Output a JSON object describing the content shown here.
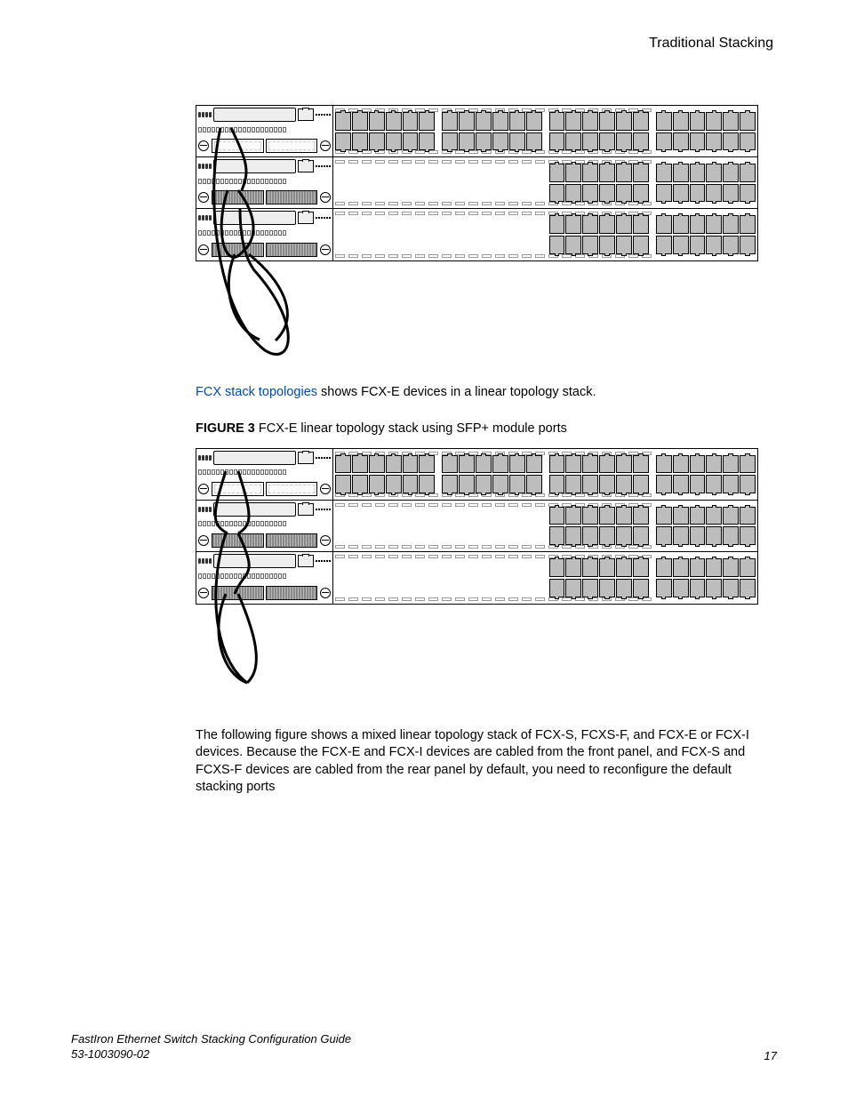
{
  "header": {
    "section_title": "Traditional Stacking"
  },
  "body": {
    "para1_link": "FCX stack topologies",
    "para1_rest": " shows FCX-E devices in a linear topology stack.",
    "figcap_label": "FIGURE 3",
    "figcap_text": " FCX-E linear topology stack using SFP+ module ports",
    "para2": "The following figure shows a mixed linear topology stack of FCX-S, FCXS-F, and FCX-E or FCX-I devices. Because the FCX-E and FCX-I devices are cabled from the front panel, and FCX-S and FCXS-F devices are cabled from the rear panel by default, you need to reconfigure the default stacking ports"
  },
  "footer": {
    "doc_title": "FastIron Ethernet Switch Stacking Configuration Guide",
    "doc_number": "53-1003090-02",
    "page_number": "17"
  },
  "figures": {
    "unit_variants": [
      {
        "groups_blank": [],
        "sfp": "empty"
      },
      {
        "groups_blank": [
          0,
          1
        ],
        "sfp": "filled"
      },
      {
        "groups_blank": [
          0,
          1
        ],
        "sfp": "filled"
      }
    ]
  }
}
